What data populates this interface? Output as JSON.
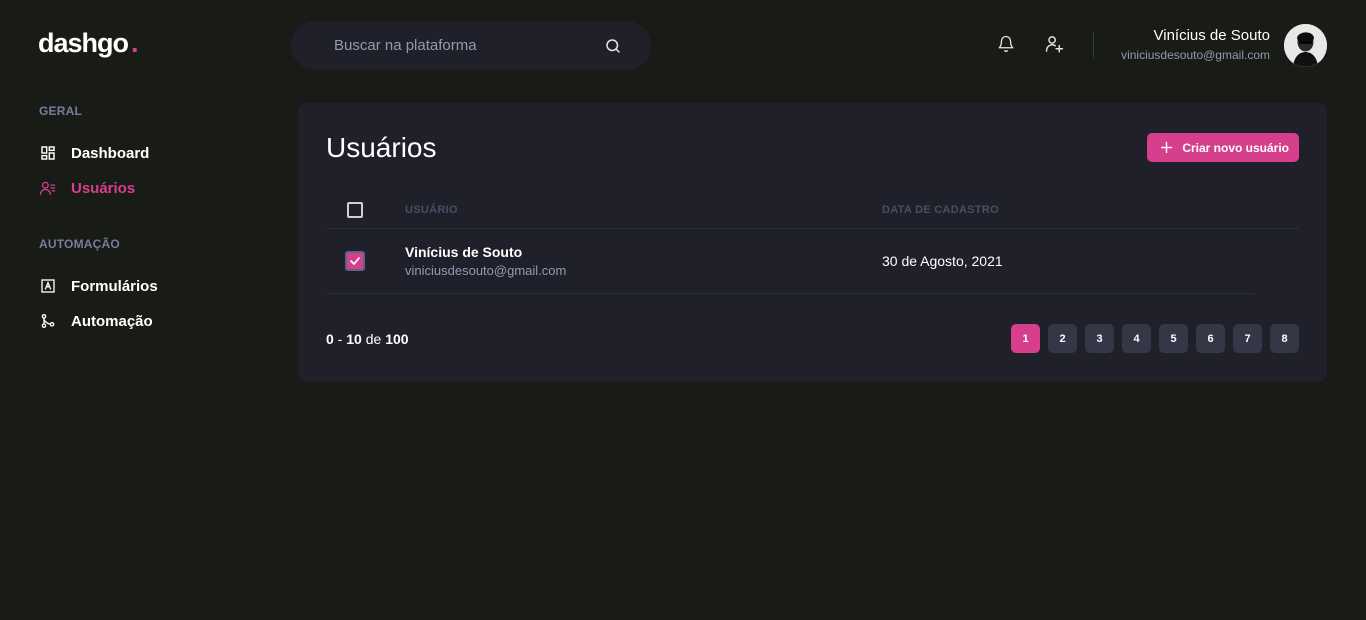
{
  "app": {
    "logo_text": "dashgo",
    "logo_dot": "."
  },
  "search": {
    "placeholder": "Buscar na plataforma"
  },
  "header": {
    "icons": [
      "bell-icon",
      "user-plus-icon",
      "search-icon"
    ],
    "user": {
      "name": "Vinícius de Souto",
      "email": "viniciusdesouto@gmail.com"
    }
  },
  "sidebar": {
    "sections": [
      {
        "title": "GERAL",
        "items": [
          {
            "label": "Dashboard",
            "icon": "dashboard-icon"
          },
          {
            "label": "Usuários",
            "icon": "users-icon",
            "active": true
          }
        ]
      },
      {
        "title": "AUTOMAÇÃO",
        "items": [
          {
            "label": "Formulários",
            "icon": "form-icon"
          },
          {
            "label": "Automação",
            "icon": "git-merge-icon"
          }
        ]
      }
    ]
  },
  "main": {
    "title": "Usuários",
    "create_button_label": "Criar novo usuário",
    "table": {
      "headers": [
        "USUÁRIO",
        "DATA DE CADASTRO"
      ],
      "rows": [
        {
          "name": "Vinícius de Souto",
          "email": "viniciusdesouto@gmail.com",
          "date": "30 de Agosto, 2021",
          "checked": true
        }
      ]
    },
    "pagination": {
      "range_start": "0",
      "range_sep": "-",
      "range_end": "10",
      "of_label": "de",
      "total": "100",
      "pages": [
        "1",
        "2",
        "3",
        "4",
        "5",
        "6",
        "7",
        "8"
      ],
      "current_page": "1"
    }
  },
  "colors": {
    "accent": "#d53f8c",
    "background": "#181b16",
    "panel": "#1f2029",
    "muted": "#9699b0"
  }
}
